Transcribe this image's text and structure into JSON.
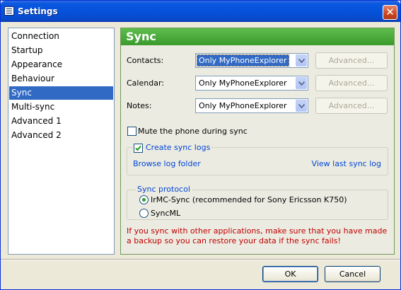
{
  "window": {
    "title": "Settings"
  },
  "sidebar": {
    "items": [
      {
        "label": "Connection",
        "selected": false
      },
      {
        "label": "Startup",
        "selected": false
      },
      {
        "label": "Appearance",
        "selected": false
      },
      {
        "label": "Behaviour",
        "selected": false
      },
      {
        "label": "Sync",
        "selected": true
      },
      {
        "label": "Multi-sync",
        "selected": false
      },
      {
        "label": "Advanced 1",
        "selected": false
      },
      {
        "label": "Advanced 2",
        "selected": false
      }
    ]
  },
  "panel": {
    "title": "Sync",
    "rows": [
      {
        "label": "Contacts:",
        "value": "Only MyPhoneExplorer",
        "advanced": "Advanced..."
      },
      {
        "label": "Calendar:",
        "value": "Only MyPhoneExplorer",
        "advanced": "Advanced..."
      },
      {
        "label": "Notes:",
        "value": "Only MyPhoneExplorer",
        "advanced": "Advanced..."
      }
    ],
    "mute_label": "Mute the phone during sync",
    "mute_checked": false,
    "logs": {
      "label": "Create sync logs",
      "checked": true,
      "browse": "Browse log folder",
      "view": "View last sync log"
    },
    "protocol": {
      "title": "Sync protocol",
      "options": [
        {
          "label": "IrMC-Sync (recommended for Sony Ericsson K750)",
          "selected": true
        },
        {
          "label": "SyncML",
          "selected": false
        }
      ]
    },
    "warning": "If you sync with other applications, make sure that you have made a backup so you can restore your data if the sync fails!"
  },
  "footer": {
    "ok": "OK",
    "cancel": "Cancel"
  },
  "colors": {
    "accent": "#316ac5",
    "header": "#3a9a2b",
    "warning": "#c00000",
    "link": "#0046d5"
  }
}
